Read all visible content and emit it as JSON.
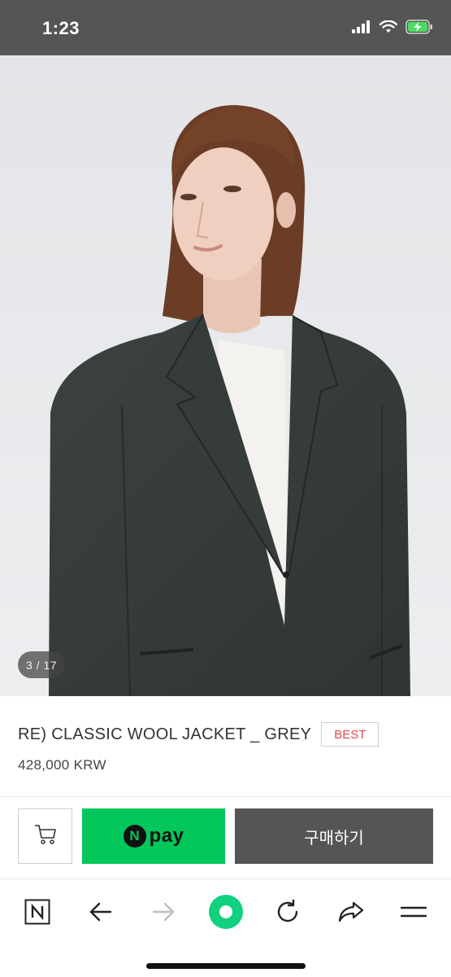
{
  "status_bar": {
    "time": "1:23",
    "icons": [
      "signal-icon",
      "wifi-icon",
      "battery-charging-icon"
    ]
  },
  "gallery": {
    "counter": "3 / 17"
  },
  "product": {
    "title": "RE) CLASSIC WOOL JACKET _ GREY",
    "badge": "BEST",
    "price": "428,000 KRW"
  },
  "actions": {
    "cart_icon": "cart-icon",
    "npay_logo": "N",
    "npay_label": "pay",
    "buy_label": "구매하기"
  },
  "toolbar": {
    "items": [
      "naver-home-icon",
      "back-arrow-icon",
      "forward-arrow-icon",
      "green-dot-icon",
      "reload-icon",
      "share-icon",
      "menu-icon"
    ]
  },
  "colors": {
    "status_bar": "#555555",
    "npay_green": "#03c75a",
    "buy_button": "#555555",
    "badge_red": "#e04a4a",
    "toolbar_green": "#11d07e"
  }
}
